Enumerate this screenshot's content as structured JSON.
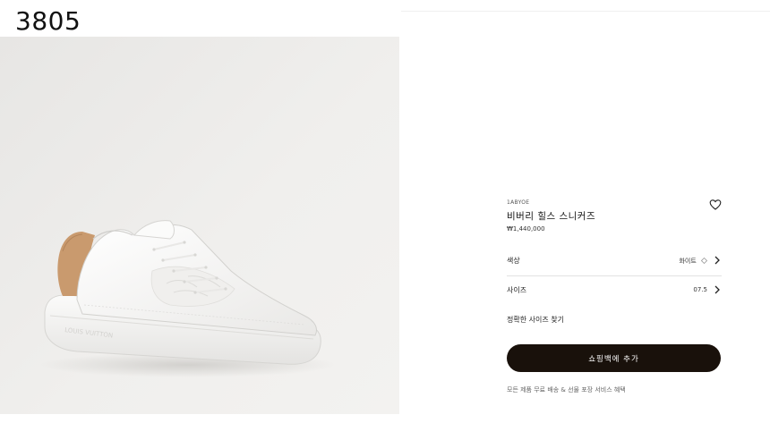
{
  "label_id": "3805",
  "product": {
    "ref": "1ABYOE",
    "title": "비버리 힐스 스니커즈",
    "price": "₩1,440,000"
  },
  "options": {
    "color_label": "색상",
    "color_value": "화이트",
    "size_label": "사이즈",
    "size_value": "07.5"
  },
  "size_guide_link": "정확한 사이즈 찾기",
  "cart_button": "쇼핑백에 추가",
  "benefits_text": "모든 제품 무료 배송 & 선물 포장 서비스 혜택",
  "icons": {
    "wishlist": "heart-icon",
    "color_chevron": "chevron-right-icon",
    "size_chevron": "chevron-right-icon",
    "color_swatch": "diamond-icon"
  },
  "colors": {
    "button_bg": "#19110b",
    "shoe_white": "#f7f7f5",
    "heel_tab": "#c99a6e"
  }
}
